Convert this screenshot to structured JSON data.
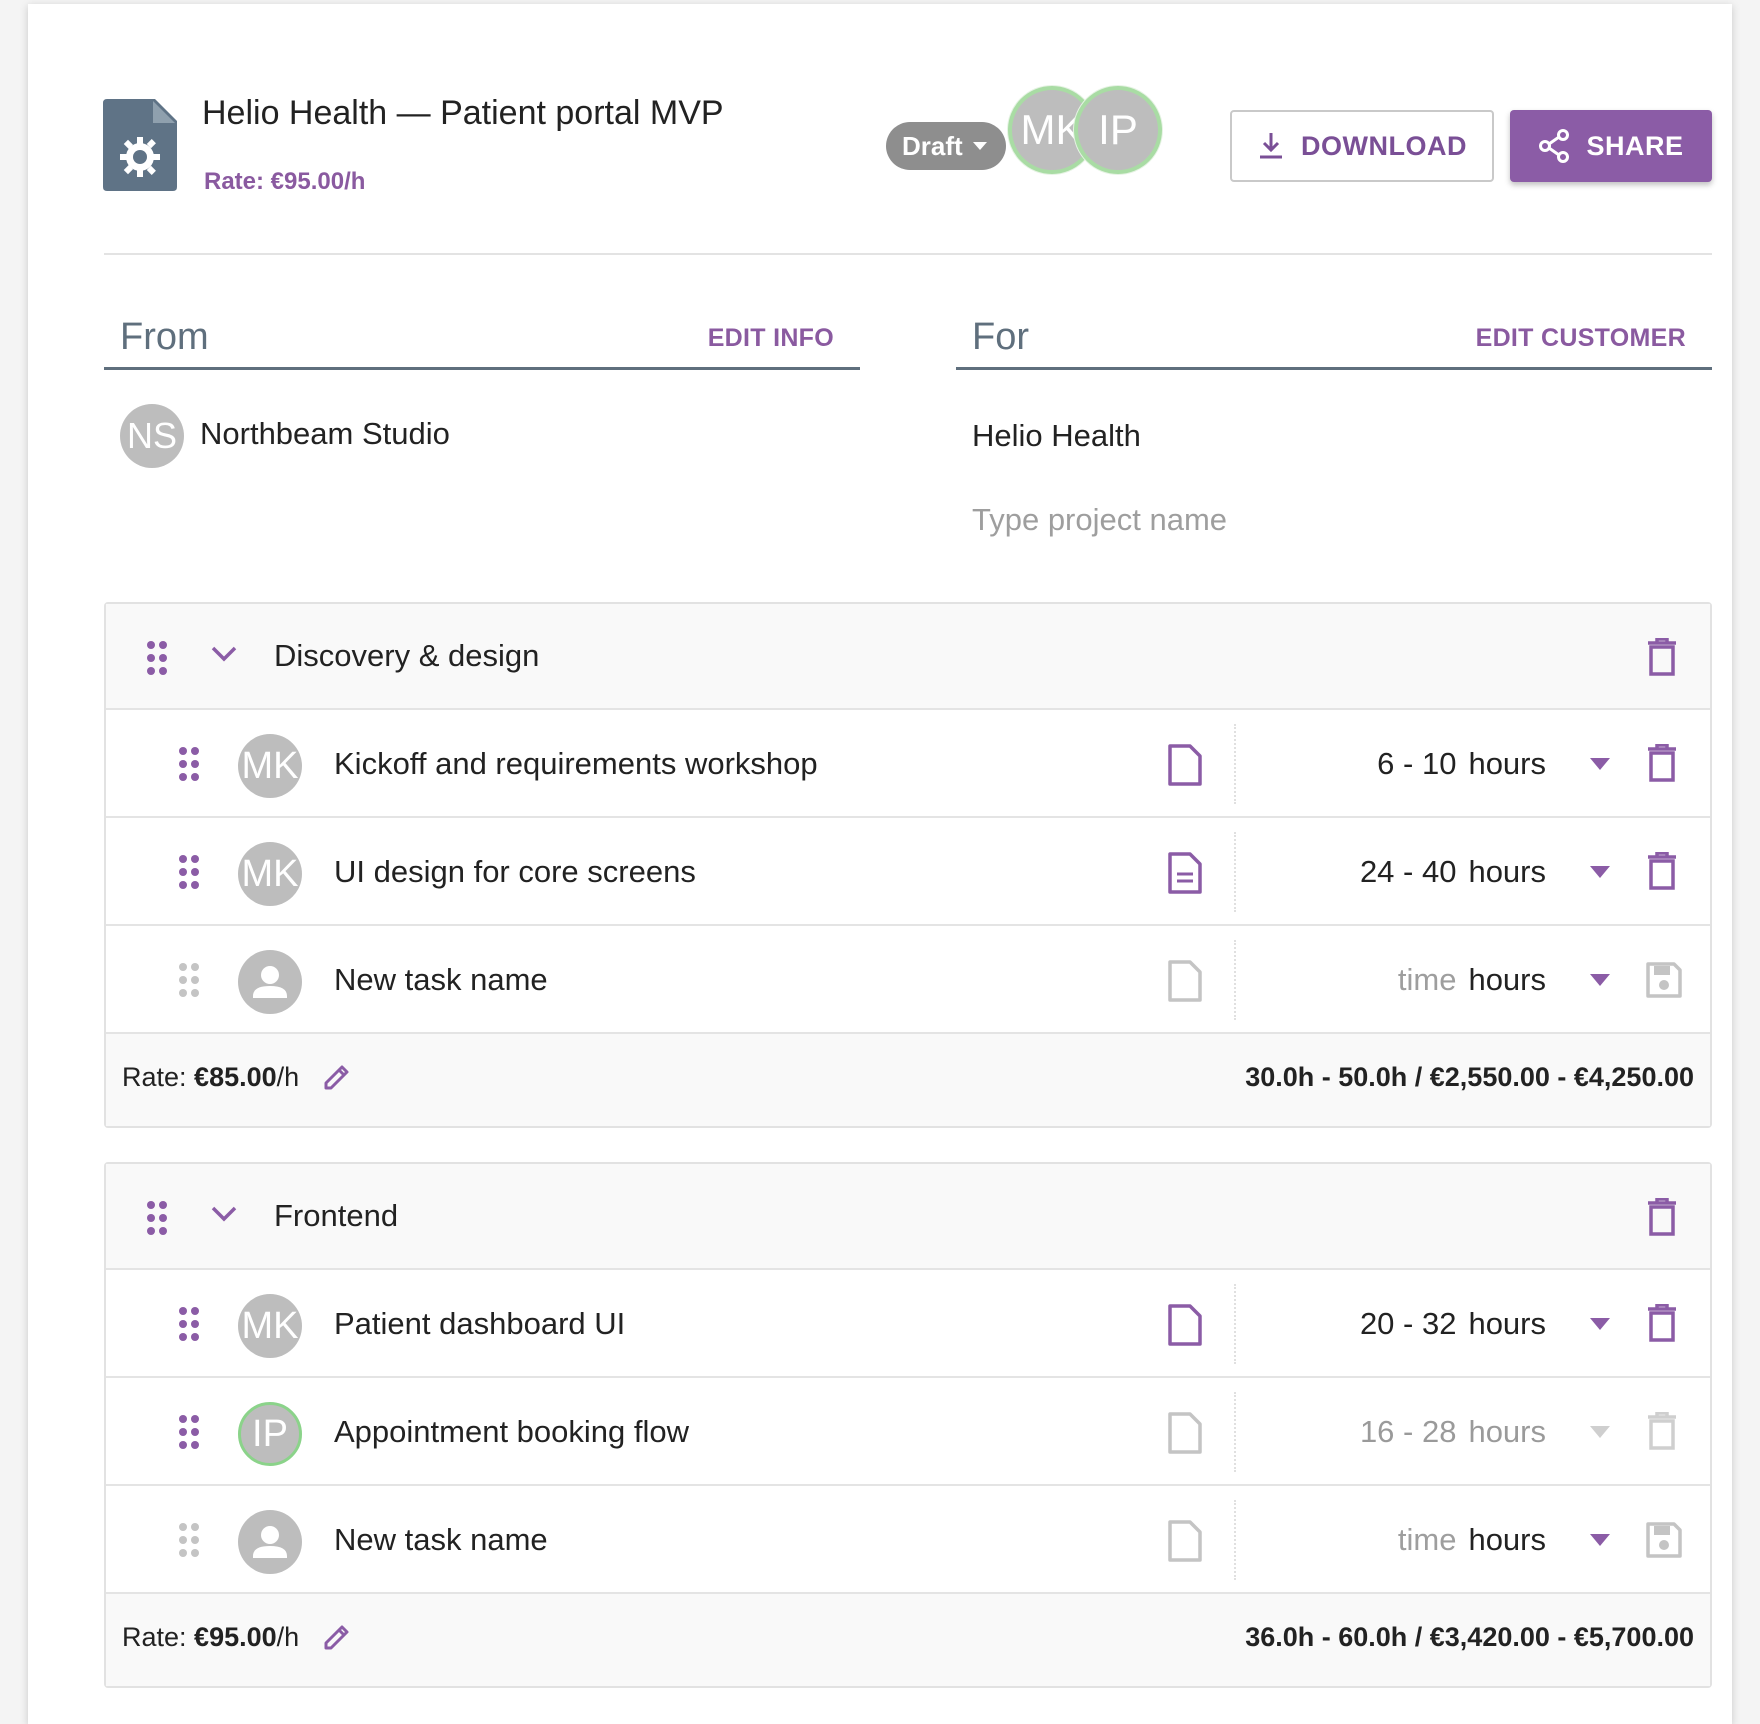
{
  "header": {
    "project_title": "Helio Health — Patient portal MVP",
    "project_rate": "Rate: €95.00/h",
    "status": "Draft",
    "collaborators": [
      "MK",
      "IP"
    ],
    "download_label": "DOWNLOAD",
    "share_label": "SHARE"
  },
  "from": {
    "title": "From",
    "edit_label": "EDIT INFO",
    "avatar": "NS",
    "company": "Northbeam Studio"
  },
  "for": {
    "title": "For",
    "edit_label": "EDIT CUSTOMER",
    "customer": "Helio Health",
    "project_placeholder": "Type project name"
  },
  "groups": [
    {
      "name": "Discovery & design",
      "tasks": [
        {
          "assignee": "MK",
          "name": "Kickoff and requirements workshop",
          "estimate": "6 - 10",
          "unit": "hours"
        },
        {
          "assignee": "MK",
          "name": "UI design for core screens",
          "estimate": "24 - 40",
          "unit": "hours"
        }
      ],
      "new_task": {
        "placeholder": "New task name",
        "time_placeholder": "time",
        "unit": "hours"
      },
      "rate_prefix": "Rate: ",
      "rate_value": "€85.00",
      "rate_suffix": "/h",
      "total": "30.0h - 50.0h / €2,550.00 - €4,250.00"
    },
    {
      "name": "Frontend",
      "tasks": [
        {
          "assignee": "MK",
          "name": "Patient dashboard UI",
          "estimate": "20 - 32",
          "unit": "hours"
        },
        {
          "assignee": "IP",
          "name": "Appointment booking flow",
          "estimate": "16 - 28",
          "unit": "hours"
        }
      ],
      "new_task": {
        "placeholder": "New task name",
        "time_placeholder": "time",
        "unit": "hours"
      },
      "rate_prefix": "Rate: ",
      "rate_value": "€95.00",
      "rate_suffix": "/h",
      "total": "36.0h - 60.0h / €3,420.00 - €5,700.00"
    }
  ],
  "colors": {
    "accent": "#8b5ca6",
    "heading_grey": "#5f6f7d",
    "online_ring": "#8bd38a"
  }
}
